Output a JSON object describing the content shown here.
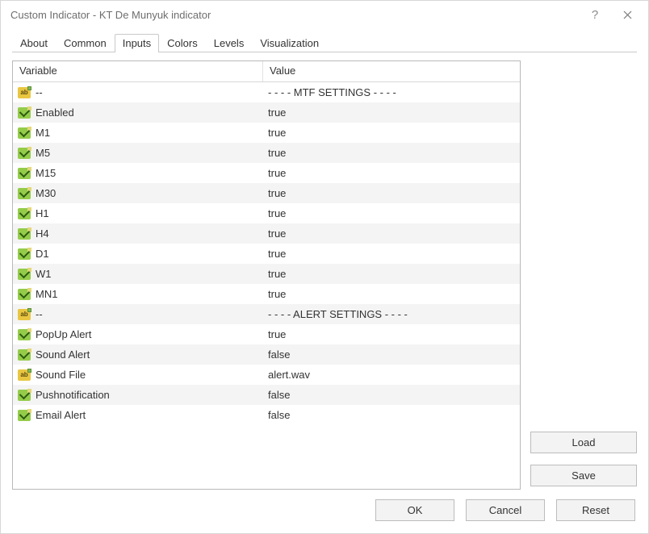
{
  "window": {
    "title": "Custom Indicator - KT De Munyuk indicator"
  },
  "tabs": [
    {
      "label": "About",
      "active": false
    },
    {
      "label": "Common",
      "active": false
    },
    {
      "label": "Inputs",
      "active": true
    },
    {
      "label": "Colors",
      "active": false
    },
    {
      "label": "Levels",
      "active": false
    },
    {
      "label": "Visualization",
      "active": false
    }
  ],
  "columns": {
    "variable": "Variable",
    "value": "Value"
  },
  "rows": [
    {
      "type": "str",
      "name": "--",
      "value": "- - - - MTF SETTINGS - - - -"
    },
    {
      "type": "bool",
      "name": "Enabled",
      "value": "true"
    },
    {
      "type": "bool",
      "name": "M1",
      "value": "true"
    },
    {
      "type": "bool",
      "name": "M5",
      "value": "true"
    },
    {
      "type": "bool",
      "name": "M15",
      "value": "true"
    },
    {
      "type": "bool",
      "name": "M30",
      "value": "true"
    },
    {
      "type": "bool",
      "name": "H1",
      "value": "true"
    },
    {
      "type": "bool",
      "name": "H4",
      "value": "true"
    },
    {
      "type": "bool",
      "name": "D1",
      "value": "true"
    },
    {
      "type": "bool",
      "name": "W1",
      "value": "true"
    },
    {
      "type": "bool",
      "name": "MN1",
      "value": "true"
    },
    {
      "type": "str",
      "name": "--",
      "value": "- - - - ALERT SETTINGS - - - -"
    },
    {
      "type": "bool",
      "name": "PopUp Alert",
      "value": "true"
    },
    {
      "type": "bool",
      "name": "Sound Alert",
      "value": "false"
    },
    {
      "type": "str",
      "name": "Sound File",
      "value": "alert.wav"
    },
    {
      "type": "bool",
      "name": "Pushnotification",
      "value": "false"
    },
    {
      "type": "bool",
      "name": "Email Alert",
      "value": "false"
    }
  ],
  "side_buttons": {
    "load": "Load",
    "save": "Save"
  },
  "footer_buttons": {
    "ok": "OK",
    "cancel": "Cancel",
    "reset": "Reset"
  }
}
